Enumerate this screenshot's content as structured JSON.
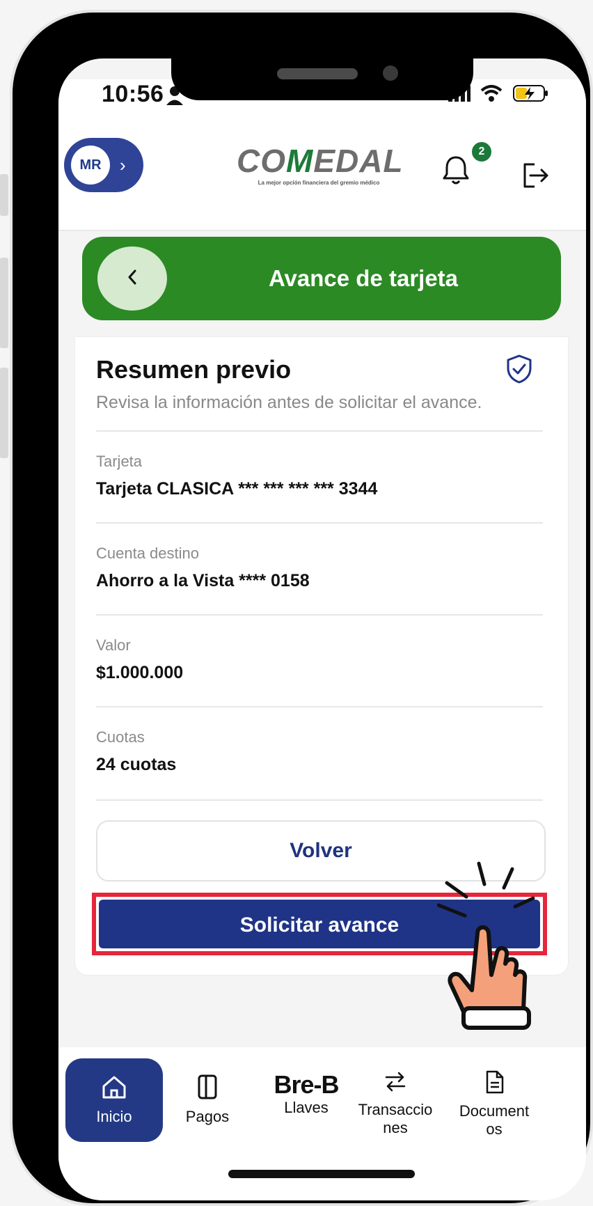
{
  "status_bar": {
    "time": "10:56"
  },
  "header": {
    "avatar_initials": "MR",
    "logo_text_pre": "CO",
    "logo_text_m": "M",
    "logo_text_post": "EDAL",
    "logo_tagline": "La mejor opción financiera del gremio médico",
    "notification_count": "2"
  },
  "title_bar": {
    "title": "Avance de tarjeta"
  },
  "summary": {
    "title": "Resumen previo",
    "subtitle": "Revisa la información antes de solicitar el avance.",
    "fields": [
      {
        "label": "Tarjeta",
        "value": "Tarjeta CLASICA *** *** *** *** 3344"
      },
      {
        "label": "Cuenta destino",
        "value": "Ahorro a la Vista **** 0158"
      },
      {
        "label": "Valor",
        "value": "$1.000.000"
      },
      {
        "label": "Cuotas",
        "value": "24 cuotas"
      }
    ],
    "back_button": "Volver",
    "submit_button": "Solicitar avance"
  },
  "nav": {
    "items": [
      {
        "label": "Inicio",
        "icon": "home-icon",
        "active": true
      },
      {
        "label": "Pagos",
        "icon": "card-icon"
      },
      {
        "label": "Llaves",
        "brand": "Bre-B",
        "icon": "breb-logo"
      },
      {
        "label": "Transaccio nes",
        "icon": "transfer-icon"
      },
      {
        "label": "Document os",
        "icon": "document-icon"
      }
    ]
  },
  "colors": {
    "primary_blue": "#1f3486",
    "green": "#2b8a24",
    "highlight_red": "#e5263b"
  }
}
